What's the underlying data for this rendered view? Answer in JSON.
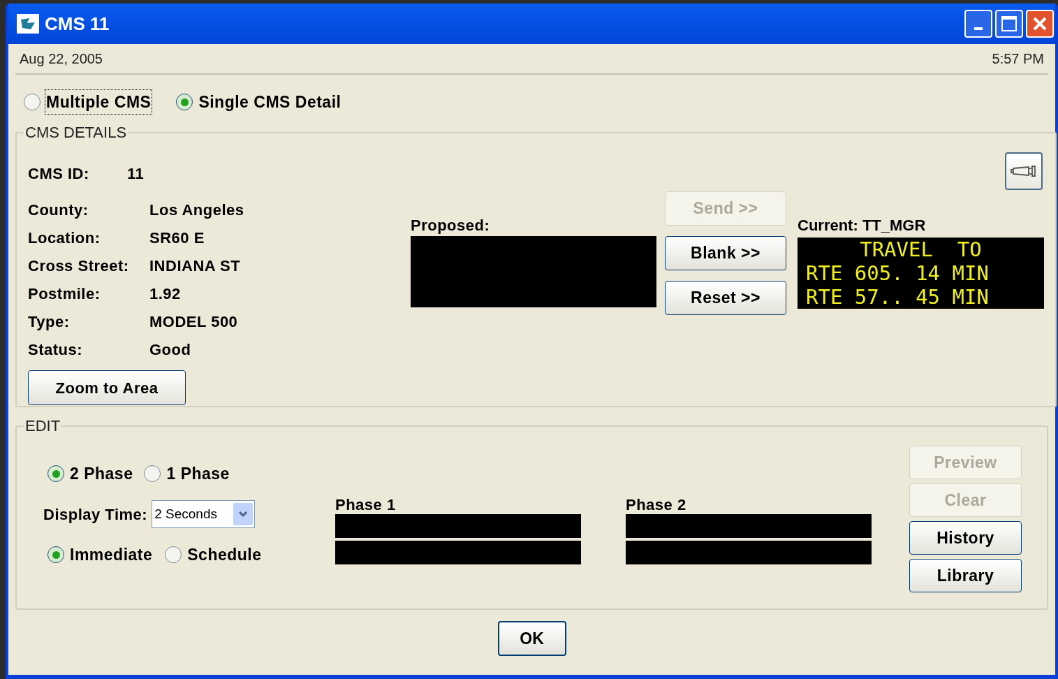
{
  "window": {
    "title": "CMS 11"
  },
  "header": {
    "date": "Aug 22, 2005",
    "time": "5:57 PM"
  },
  "view_modes": [
    {
      "label": "Multiple CMS",
      "selected": false,
      "focused": true
    },
    {
      "label": "Single CMS Detail",
      "selected": true,
      "focused": false
    }
  ],
  "cms_details": {
    "title": "CMS DETAILS",
    "id_label": "CMS ID:",
    "id_value": "11",
    "fields": [
      {
        "label": "County:",
        "value": "Los Angeles"
      },
      {
        "label": "Location:",
        "value": "SR60 E"
      },
      {
        "label": "Cross Street:",
        "value": "INDIANA ST"
      },
      {
        "label": "Postmile:",
        "value": "1.92"
      },
      {
        "label": "Type:",
        "value": "MODEL 500"
      },
      {
        "label": "Status:",
        "value": "Good"
      }
    ],
    "zoom_button": "Zoom to Area",
    "proposed_label": "Proposed:",
    "actions": [
      {
        "label": "Send >>",
        "disabled": true
      },
      {
        "label": "Blank >>",
        "disabled": false
      },
      {
        "label": "Reset >>",
        "disabled": false
      }
    ],
    "current": {
      "label": "Current: TT_MGR",
      "lines": [
        "TRAVEL  TO",
        "RTE 605. 14 MIN",
        "RTE 57.. 45 MIN"
      ]
    }
  },
  "edit": {
    "title": "EDIT",
    "phase_modes": [
      {
        "label": "2 Phase",
        "selected": true
      },
      {
        "label": "1 Phase",
        "selected": false
      }
    ],
    "display_time": {
      "label": "Display Time:",
      "value": "2 Seconds"
    },
    "timing": [
      {
        "label": "Immediate",
        "selected": true
      },
      {
        "label": "Schedule",
        "selected": false
      }
    ],
    "phases": [
      {
        "label": "Phase 1"
      },
      {
        "label": "Phase 2"
      }
    ],
    "buttons": [
      {
        "label": "Preview",
        "disabled": true
      },
      {
        "label": "Clear",
        "disabled": true
      },
      {
        "label": "History",
        "disabled": false
      },
      {
        "label": "Library",
        "disabled": false
      }
    ]
  },
  "ok_button": "OK"
}
